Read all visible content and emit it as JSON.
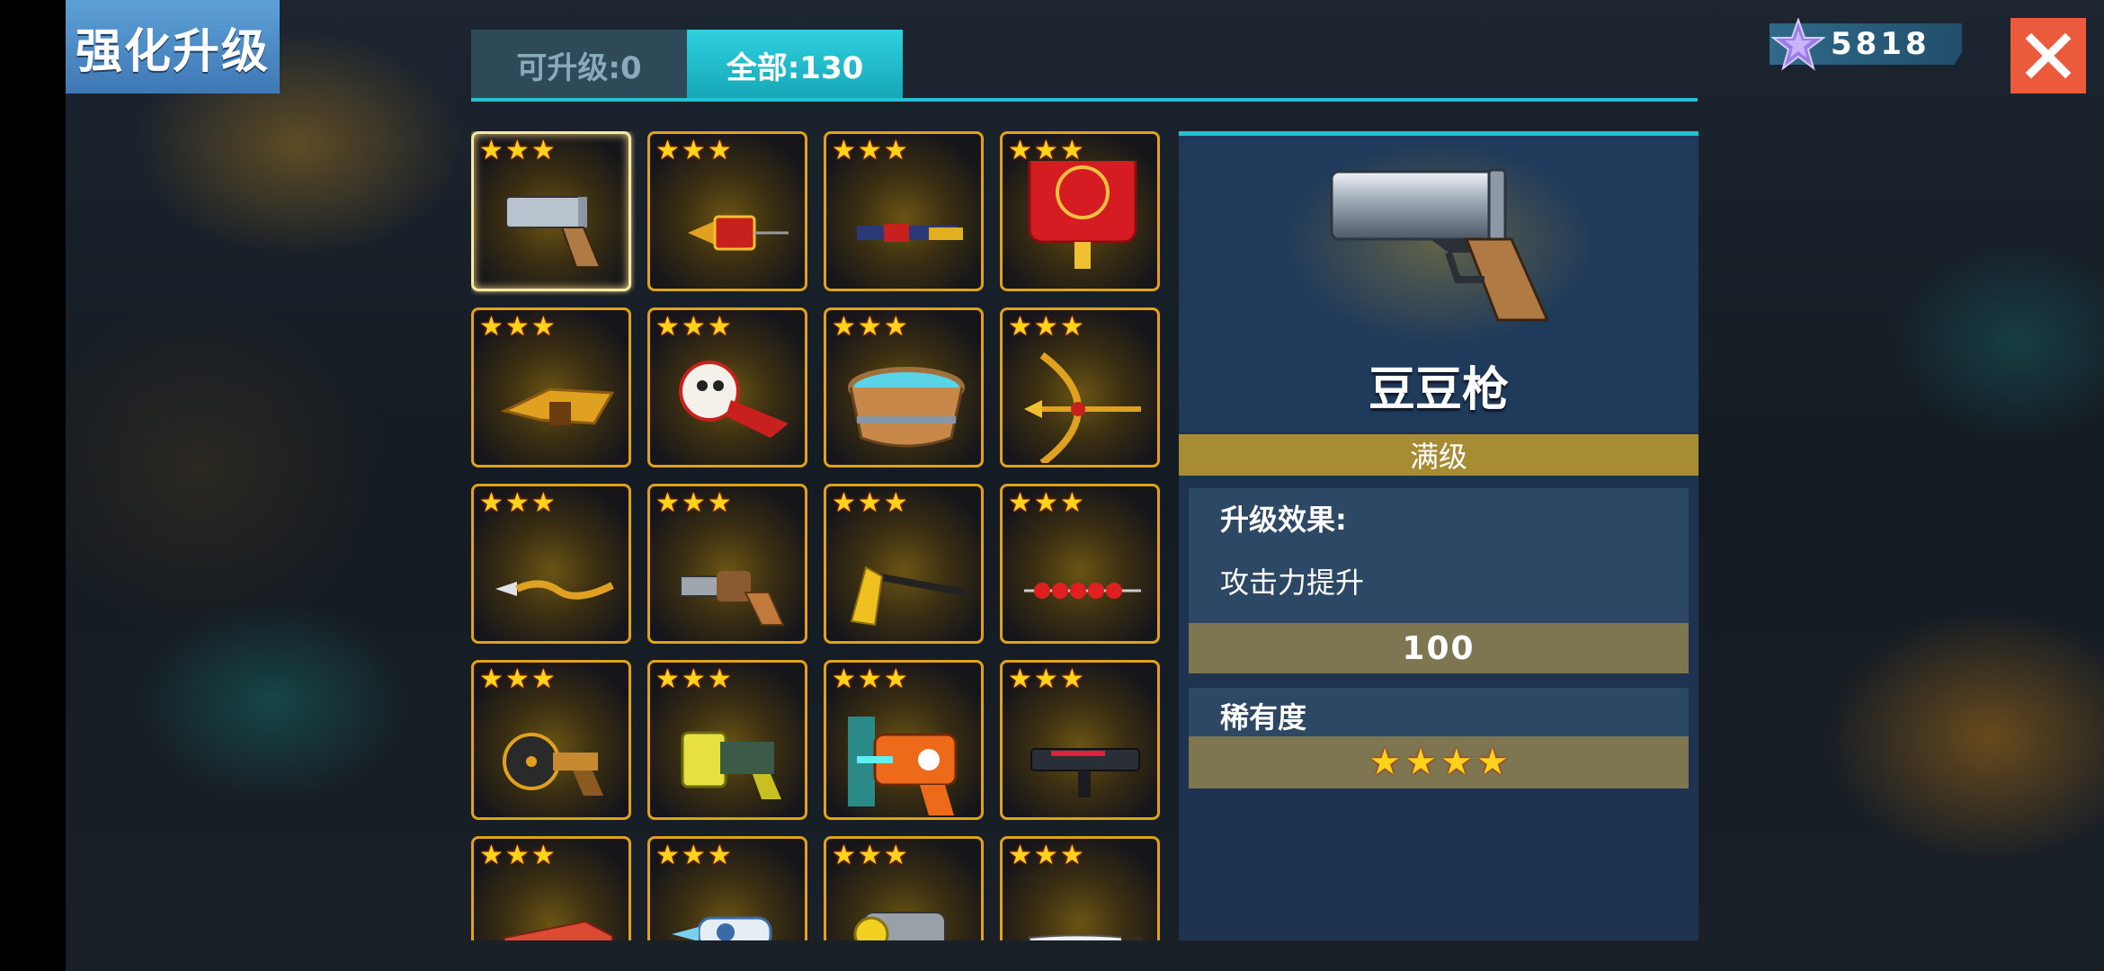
{
  "header": {
    "title": "强化升级"
  },
  "tabs": [
    {
      "label": "可升级:0",
      "active": false
    },
    {
      "label": "全部:130",
      "active": true
    }
  ],
  "currency": {
    "value": "5818",
    "icon": "purple-star-gem-icon"
  },
  "close": {
    "icon": "close-icon"
  },
  "items": [
    {
      "name": "豆豆枪",
      "icon": "pea-pistol-icon",
      "stars": 3,
      "selected": true
    },
    {
      "icon": "firecracker-rocket-icon",
      "stars": 3
    },
    {
      "icon": "firecracker-rifle-icon",
      "stars": 3
    },
    {
      "icon": "red-lantern-icon",
      "stars": 3
    },
    {
      "icon": "golden-dragon-gun-icon",
      "stars": 3
    },
    {
      "icon": "lion-dance-launcher-icon",
      "stars": 3
    },
    {
      "icon": "wooden-bathtub-icon",
      "stars": 3
    },
    {
      "icon": "golden-crossbow-icon",
      "stars": 3
    },
    {
      "icon": "golden-spear-icon",
      "stars": 3
    },
    {
      "icon": "revolver-icon",
      "stars": 3
    },
    {
      "icon": "golden-axe-icon",
      "stars": 3
    },
    {
      "icon": "candied-haws-skewer-icon",
      "stars": 3
    },
    {
      "icon": "disc-blaster-icon",
      "stars": 3
    },
    {
      "icon": "battery-blaster-icon",
      "stars": 3
    },
    {
      "icon": "orange-ray-gun-icon",
      "stars": 3
    },
    {
      "icon": "dark-smg-icon",
      "stars": 3
    },
    {
      "icon": "red-brick-icon",
      "stars": 3
    },
    {
      "icon": "ice-blaster-icon",
      "stars": 3
    },
    {
      "icon": "yellow-cannon-icon",
      "stars": 3
    },
    {
      "icon": "knife-icon",
      "stars": 3
    }
  ],
  "detail": {
    "name": "豆豆枪",
    "icon": "pea-pistol-icon",
    "level_text": "满级",
    "effect_label": "升级效果:",
    "effect_text": "攻击力提升",
    "effect_value": "100",
    "rarity_label": "稀有度",
    "rarity_stars": 4
  },
  "colors": {
    "cell_border": "#e1a218",
    "accent_cyan": "#22c2d2",
    "level_bar": "#a88c34",
    "close_button": "#ec5a3c",
    "panel": "#1e3350"
  }
}
